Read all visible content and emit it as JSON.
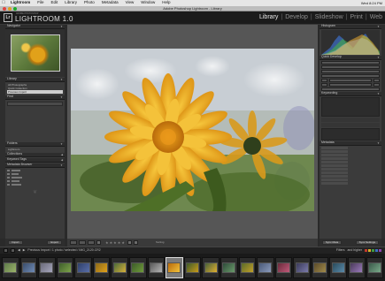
{
  "menubar": {
    "items": [
      "Lightroom",
      "File",
      "Edit",
      "Library",
      "Photo",
      "Metadata",
      "View",
      "Window",
      "Help"
    ],
    "time": "Wed 8:24 PM"
  },
  "window": {
    "title": "Adobe Photoshop Lightroom - Library"
  },
  "identity": {
    "badge": "Lr",
    "subtitle": "ADOBE PHOTOSHOP",
    "product": "LIGHTROOM 1.0"
  },
  "modules": [
    {
      "label": "Library",
      "active": true
    },
    {
      "label": "Develop",
      "active": false
    },
    {
      "label": "Slideshow",
      "active": false
    },
    {
      "label": "Print",
      "active": false
    },
    {
      "label": "Web",
      "active": false
    }
  ],
  "left_panels": {
    "navigator": "Navigator",
    "library": "Library",
    "library_items": [
      {
        "label": "All Photographs",
        "count": "",
        "selected": false
      },
      {
        "label": "Quick Collection",
        "count": "",
        "selected": false
      },
      {
        "label": "Previous Import",
        "count": "",
        "selected": true
      }
    ],
    "find": "Find",
    "collections": "Collections",
    "keyword_tags": "Keyword Tags",
    "metadata_browser": "Metadata Browser",
    "folders": "Folders",
    "folder_field": "Lightroom"
  },
  "left_buttons": {
    "import": "Import",
    "export": "Export"
  },
  "right_panels": {
    "histogram": "Histogram",
    "quick_develop": "Quick Develop",
    "keywording": "Keywording",
    "metadata": "Metadata"
  },
  "right_buttons": {
    "sync_meta": "Sync Meta",
    "sync_settings": "Sync Settings"
  },
  "toolbar": {
    "info": "Sorting",
    "stars": "★★★★★"
  },
  "filmstrip": {
    "source": "Previous Import / 1 photo / selected / IMG_2120.CR2",
    "filters_label": "Filters",
    "rating_filter": "and higher",
    "thumb_count": 21,
    "selected_index": 9
  },
  "colors": {
    "accent_selected": "#cfcfcf",
    "panel_bg": "#3b3b3b",
    "center_bg": "#565656",
    "menubar_bg": "#e6e6e6",
    "label_swatches": [
      "#c0392b",
      "#d4b02a",
      "#3f9b3f",
      "#3b6fbf",
      "#8e44ad"
    ]
  }
}
